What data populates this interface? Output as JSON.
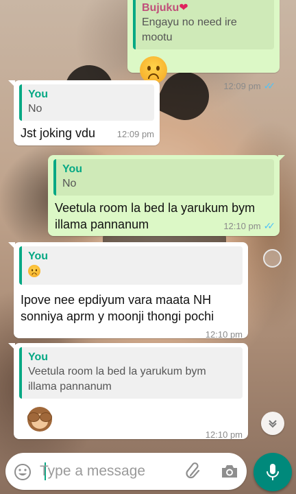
{
  "messages": [
    {
      "quote_name": "Bujuku",
      "quote_text": "Engayu no need ire mootu",
      "body_emoji": "disappointed-face",
      "time": "12:09 pm",
      "status": "read"
    },
    {
      "quote_name": "You",
      "quote_text": "No",
      "body": "Jst joking vdu",
      "time": "12:09 pm"
    },
    {
      "quote_name": "You",
      "quote_text": "No",
      "body": "Veetula room la bed la yarukum bym illama pannanum",
      "time": "12:10 pm",
      "status": "read"
    },
    {
      "quote_name": "You",
      "quote_emoji": "disappointed-face",
      "body": "Ipove nee epdiyum vara maata NH sonniya aprm y moonji thongi pochi",
      "time": "12:10 pm"
    },
    {
      "quote_name": "You",
      "quote_text": "Veetula room la bed la yarukum bym illama pannanum",
      "body_emoji": "see-no-evil-monkey",
      "time": "12:10 pm"
    }
  ],
  "composer": {
    "placeholder": "Type a message",
    "icons": [
      "emoji-icon",
      "attach-icon",
      "camera-icon",
      "mic-icon"
    ]
  },
  "colors": {
    "incoming": "#ffffff",
    "outgoing": "#dcf8c6",
    "accent": "#06a884",
    "mic_button": "#00897b",
    "read_ticks": "#4fc3f7"
  }
}
